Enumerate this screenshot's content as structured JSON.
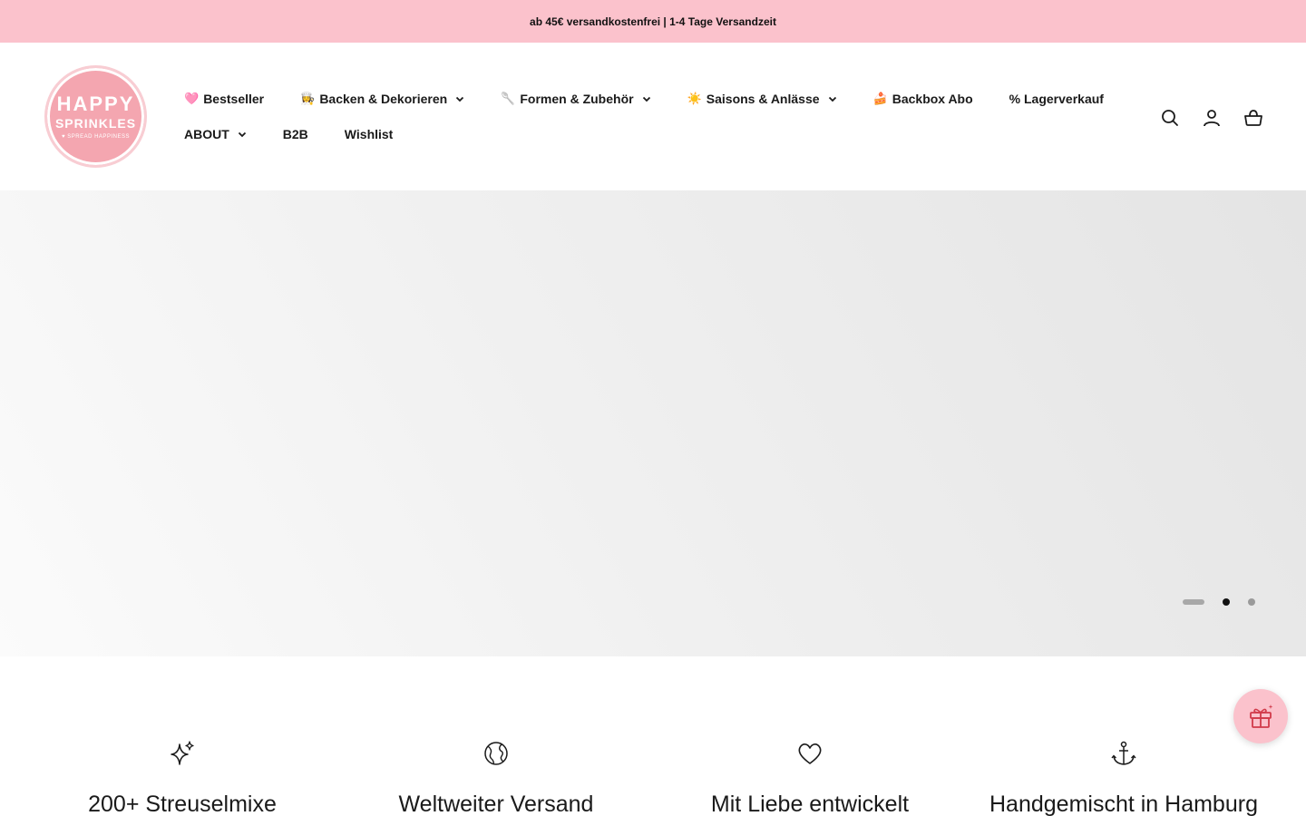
{
  "announcement": "ab 45€ versandkostenfrei | 1-4 Tage Versandzeit",
  "logo": {
    "line1": "HAPPY",
    "line2": "SPRINKLES",
    "line3": "♥ SPREAD HAPPINESS"
  },
  "nav": {
    "row1": [
      {
        "emoji": "🩷",
        "label": "Bestseller",
        "dropdown": false
      },
      {
        "emoji": "👩‍🍳",
        "label": "Backen & Dekorieren",
        "dropdown": true
      },
      {
        "emoji": "🥄",
        "label": "Formen & Zubehör",
        "dropdown": true
      },
      {
        "emoji": "☀️",
        "label": "Saisons & Anlässe",
        "dropdown": true
      },
      {
        "emoji": "🍰",
        "label": "Backbox Abo",
        "dropdown": false
      },
      {
        "emoji": "",
        "label": "% Lagerverkauf",
        "dropdown": false
      }
    ],
    "row2": [
      {
        "label": "ABOUT",
        "dropdown": true
      },
      {
        "label": "B2B",
        "dropdown": false
      },
      {
        "label": "Wishlist",
        "dropdown": false
      }
    ]
  },
  "header_icons": [
    "search-icon",
    "account-icon",
    "cart-icon"
  ],
  "hero": {
    "slides": 3,
    "active_slide": 2
  },
  "features": [
    {
      "icon": "sparkle-icon",
      "title": "200+ Streuselmixe"
    },
    {
      "icon": "globe-icon",
      "title": "Weltweiter Versand"
    },
    {
      "icon": "heart-icon",
      "title": "Mit Liebe entwickelt"
    },
    {
      "icon": "anchor-icon",
      "title": "Handgemischt in Hamburg"
    }
  ],
  "colors": {
    "announcement_bg": "#fbc2cc",
    "logo_pink": "#f4a6b0",
    "text": "#1a1a1a"
  }
}
